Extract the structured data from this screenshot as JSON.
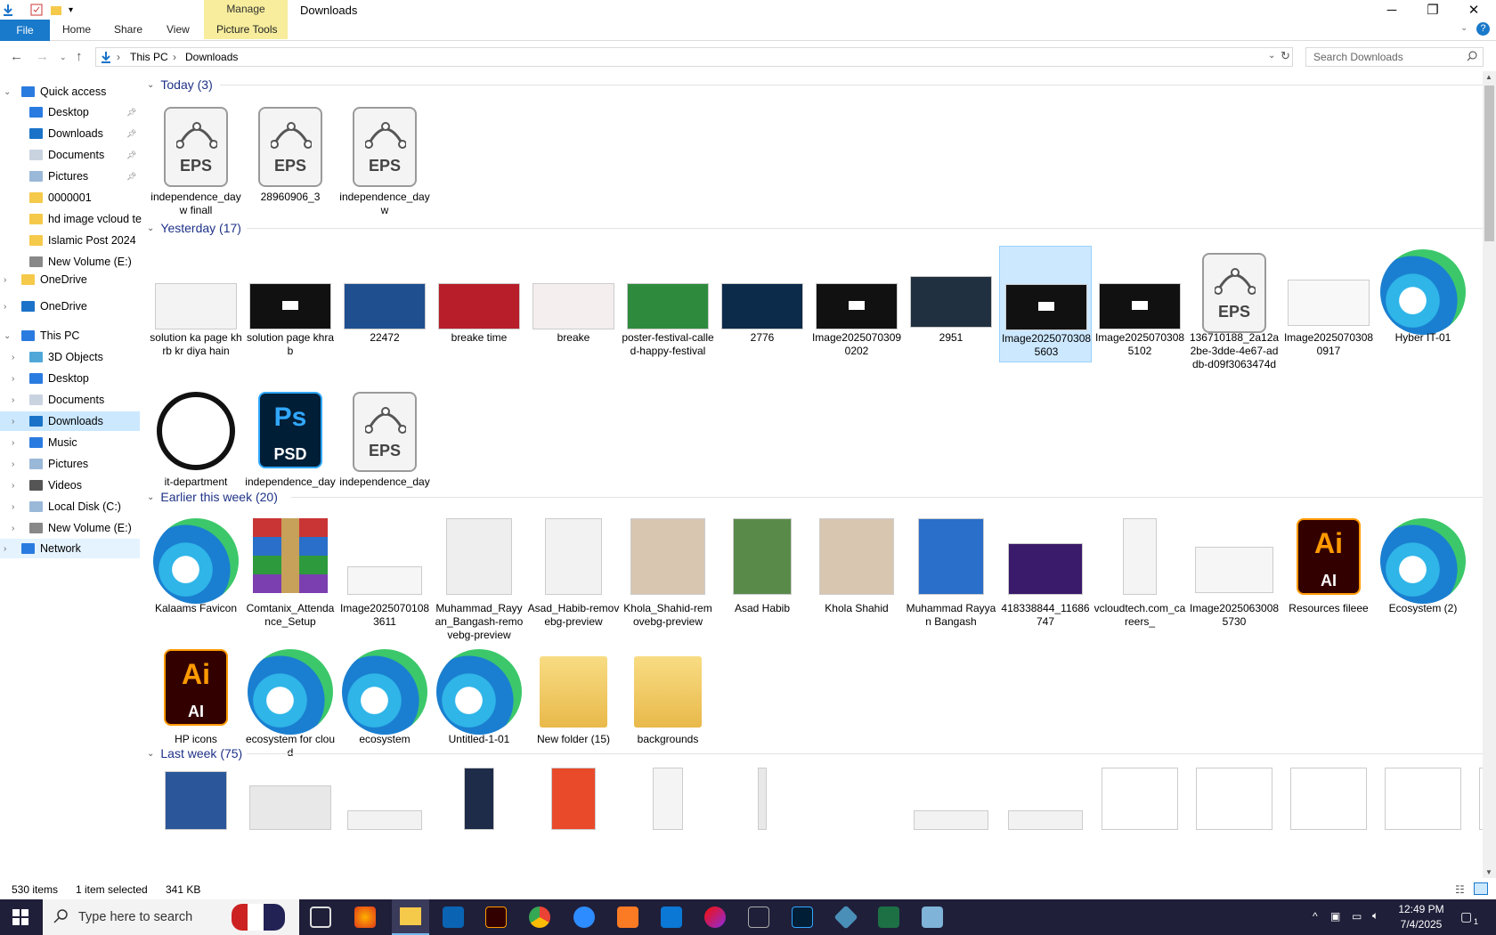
{
  "window": {
    "title": "Downloads",
    "manage_tab": "Manage",
    "ribbon_tabs": [
      "File",
      "Home",
      "Share",
      "View",
      "Picture Tools"
    ],
    "controls": {
      "minimize": "─",
      "restore": "❐",
      "close": "✕"
    }
  },
  "address": {
    "crumbs": [
      "This PC",
      "Downloads"
    ],
    "search_placeholder": "Search Downloads"
  },
  "nav": {
    "quick_access": "Quick access",
    "quick_items": [
      "Desktop",
      "Downloads",
      "Documents",
      "Pictures",
      "0000001",
      "hd image vcloud te",
      "Islamic Post 2024",
      "New Volume (E:)"
    ],
    "onedrive_1": "OneDrive",
    "onedrive_2": "OneDrive",
    "this_pc": "This PC",
    "pc_items": [
      "3D Objects",
      "Desktop",
      "Documents",
      "Downloads",
      "Music",
      "Pictures",
      "Videos",
      "Local Disk (C:)",
      "New Volume (E:)"
    ],
    "network": "Network"
  },
  "groups": {
    "today": "Today (3)",
    "yesterday": "Yesterday (17)",
    "earlier": "Earlier this week (20)",
    "last_week": "Last week (75)"
  },
  "today_items": [
    "independence_dayw finall",
    "28960906_3",
    "independence_dayw"
  ],
  "yesterday_row1": [
    "solution ka page khrb kr diya hain",
    "solution page khrab",
    "22472",
    "breake time",
    "breake",
    "poster-festival-called-happy-festival",
    "2776",
    "Image20250703090202",
    "2951",
    "Image20250703085603",
    "Image20250703085102",
    "136710188_2a12a2be-3dde-4e67-addb-d09f3063474d",
    "Image20250703080917",
    "Hyber IT-01"
  ],
  "yesterday_row2": [
    "it-department",
    "independence_day",
    "independence_day"
  ],
  "earlier_row1": [
    "Kalaams Favicon",
    "Comtanix_Attendance_Setup",
    "Image20250701083611",
    "Muhammad_Rayyan_Bangash-removebg-preview",
    "Asad_Habib-removebg-preview",
    "Khola_Shahid-removebg-preview",
    "Asad Habib",
    "Khola Shahid",
    "Muhammad Rayyan Bangash",
    "418338844_11686747",
    "vcloudtech.com_careers_",
    "Image20250630085730",
    "Resources fileee",
    "Ecosystem (2)"
  ],
  "earlier_row2": [
    "HP icons",
    "ecosystem for cloud",
    "ecosystem",
    "Untitled-1-01",
    "New folder (15)",
    "backgrounds"
  ],
  "icon_text": {
    "eps": "EPS",
    "psd": "PSD",
    "ps": "Ps",
    "ai": "Ai",
    "ai_small": "AI"
  },
  "status": {
    "count": "530 items",
    "selected": "1 item selected",
    "size": "341 KB"
  },
  "taskbar": {
    "search": "Type here to search",
    "time": "12:49 PM",
    "date": "7/4/2025",
    "notif": "1"
  },
  "colors": {
    "accent": "#1979ca",
    "selection": "#cce8ff",
    "group_header": "#1e3287"
  }
}
